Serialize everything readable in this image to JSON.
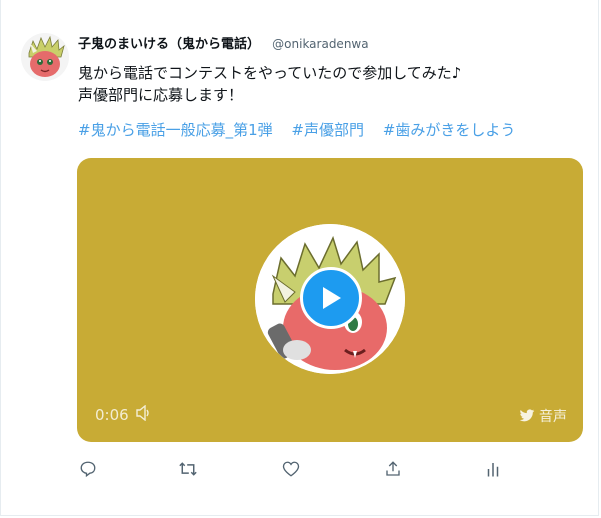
{
  "tweet": {
    "display_name": "子鬼のまいける（鬼から電話）",
    "handle": "@onikaradenwa",
    "text_line1": "鬼から電話でコンテストをやっていたので参加してみた♪",
    "text_line2": "声優部門に応募します！",
    "hashtags": [
      "#鬼から電話一般応募_第1弾",
      "#声優部門",
      "#歯みがきをしよう"
    ]
  },
  "media": {
    "duration": "0:06",
    "badge_label": "音声",
    "background_color": "#c8ab35",
    "play_icon": "play-icon",
    "volume_icon": "volume-icon",
    "brand_icon": "twitter-bird-icon"
  },
  "actions": [
    "reply-icon",
    "retweet-icon",
    "like-icon",
    "share-icon",
    "analytics-icon"
  ]
}
